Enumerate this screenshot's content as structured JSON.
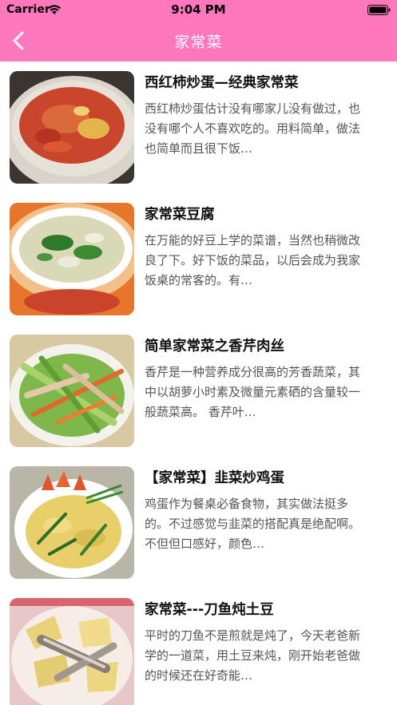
{
  "status_bar": {
    "carrier": "Carrier",
    "time": "9:04 PM"
  },
  "nav": {
    "title": "家常菜",
    "back_icon": "chevron-left-icon",
    "background": "#ff77bd"
  },
  "recipes": [
    {
      "title": "西红柿炒蛋—经典家常菜",
      "description": "西红柿炒蛋估计没有哪家儿没有做过，也没有哪个人不喜欢吃的。用料简单，做法也简单而且很下饭…"
    },
    {
      "title": "家常菜豆腐",
      "description": "在万能的好豆上学的菜谱，当然也稍微改良了下。好下饭的菜品，以后会成为我家饭桌的常客的。有…"
    },
    {
      "title": "简单家常菜之香芹肉丝",
      "description": "香芹是一种营养成分很高的芳香蔬菜，其中以胡萝小时素及微量元素硒的含量较一般蔬菜高。 香芹叶…"
    },
    {
      "title": "【家常菜】韭菜炒鸡蛋",
      "description": "鸡蛋作为餐桌必备食物，其实做法挺多的。不过感觉与韭菜的搭配真是绝配啊。不但但口感好，颜色…"
    },
    {
      "title": "家常菜---刀鱼炖土豆",
      "description": "平时的刀鱼不是煎就是炖了，今天老爸新学的一道菜，用土豆来炖，刚开始老爸做的时候还在好奇能…"
    }
  ]
}
